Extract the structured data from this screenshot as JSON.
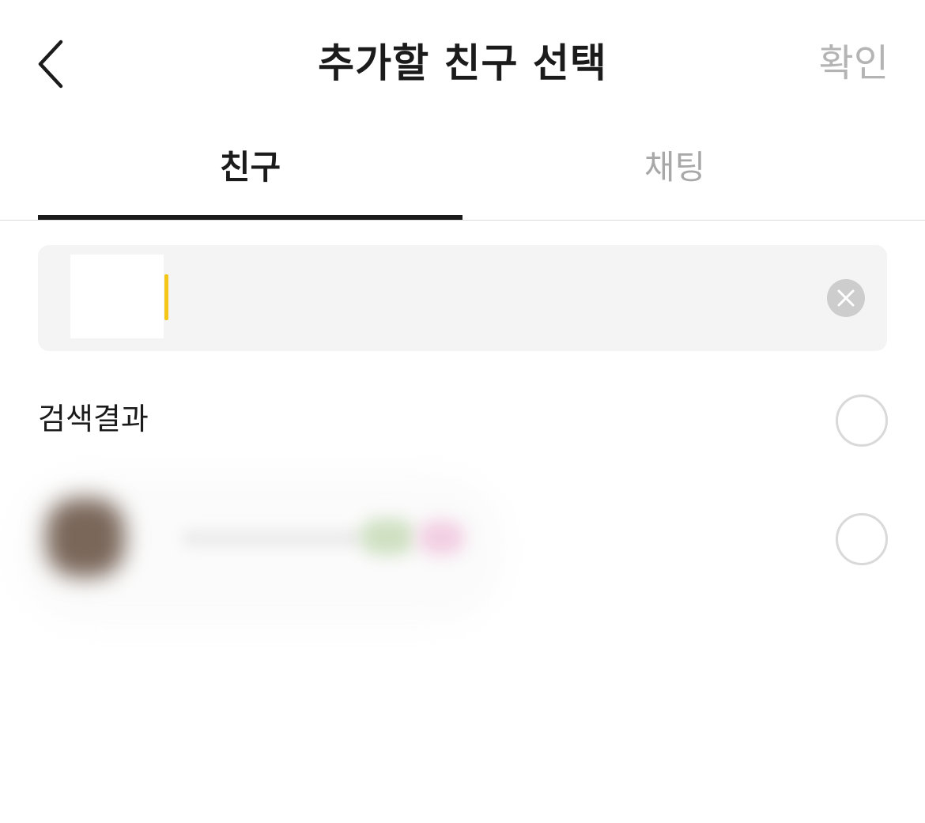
{
  "header": {
    "back_icon": "chevron-left-icon",
    "title": "추가할 친구 선택",
    "confirm_label": "확인"
  },
  "tabs": [
    {
      "label": "친구",
      "active": true
    },
    {
      "label": "채팅",
      "active": false
    }
  ],
  "search": {
    "value": "",
    "clear_icon": "close-icon"
  },
  "results": {
    "section_label": "검색결과",
    "items": [
      {
        "name": "",
        "selected": false
      }
    ]
  },
  "colors": {
    "caret": "#f5c518",
    "active_tab": "#1b1b1b",
    "inactive_text": "#a8a8a8"
  }
}
